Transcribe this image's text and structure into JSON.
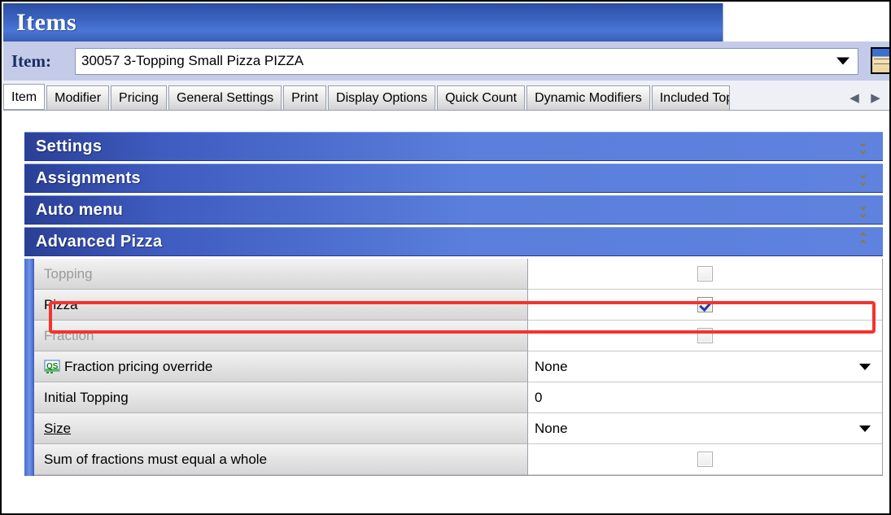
{
  "window": {
    "title": "Items"
  },
  "item_selector": {
    "label": "Item:",
    "value": "30057 3-Topping Small Pizza PIZZA",
    "placeholder": "",
    "dropdown_icon": "chevron-down-icon",
    "side_button_icon": "form-window-icon"
  },
  "tabs": {
    "items": [
      {
        "label": "Item",
        "active": true
      },
      {
        "label": "Modifier",
        "active": false
      },
      {
        "label": "Pricing",
        "active": false
      },
      {
        "label": "General Settings",
        "active": false
      },
      {
        "label": "Print",
        "active": false
      },
      {
        "label": "Display Options",
        "active": false
      },
      {
        "label": "Quick Count",
        "active": false
      },
      {
        "label": "Dynamic Modifiers",
        "active": false
      },
      {
        "label": "Included Top",
        "active": false
      }
    ],
    "scroll_left": "◀",
    "scroll_right": "▶"
  },
  "sections": [
    {
      "title": "Settings",
      "expanded": false,
      "chevron": "chevron-double-down-icon"
    },
    {
      "title": "Assignments",
      "expanded": false,
      "chevron": "chevron-double-down-icon"
    },
    {
      "title": "Auto menu",
      "expanded": false,
      "chevron": "chevron-double-down-icon"
    },
    {
      "title": "Advanced Pizza",
      "expanded": true,
      "chevron": "chevron-double-up-icon"
    }
  ],
  "advanced_pizza_rows": [
    {
      "label": "Topping",
      "type": "checkbox",
      "checked": false,
      "disabled": true,
      "value": "",
      "highlighted": false
    },
    {
      "label": "Pizza",
      "type": "checkbox",
      "checked": true,
      "disabled": false,
      "value": "",
      "highlighted": true
    },
    {
      "label": "Fraction",
      "type": "checkbox",
      "checked": false,
      "disabled": true,
      "value": "",
      "highlighted": false
    },
    {
      "label": "Fraction pricing override",
      "type": "dropdown",
      "checked": false,
      "disabled": false,
      "value": "None",
      "icon": "qs-badge-icon",
      "highlighted": false
    },
    {
      "label": "Initial Topping",
      "type": "text",
      "checked": false,
      "disabled": false,
      "value": "0",
      "highlighted": false
    },
    {
      "label": "Size",
      "type": "dropdown",
      "checked": false,
      "disabled": false,
      "value": "None",
      "underline": true,
      "highlighted": false
    },
    {
      "label": "Sum of fractions must equal a whole",
      "type": "checkbox",
      "checked": false,
      "disabled": true,
      "value": "",
      "highlighted": false
    }
  ],
  "annotation": {
    "highlight_color": "#f5332c",
    "target_row": "Pizza"
  },
  "colors": {
    "title_bar_blue": "#3a63c0",
    "section_header_blue": "#3f5cc0",
    "accent_lavender": "#c3cbe8",
    "check_blue": "#1f3e9e",
    "chevron_gold": "#8d7a3f"
  }
}
